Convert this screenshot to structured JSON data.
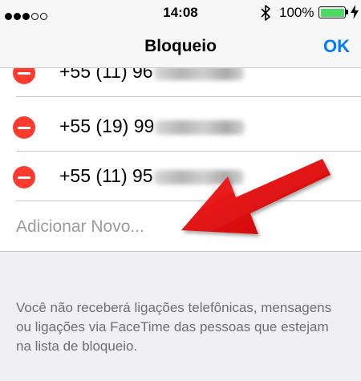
{
  "status_bar": {
    "time": "14:08",
    "battery_percent": "100%",
    "signal_bars_filled": 3,
    "signal_bars_total": 5,
    "battery_level": 1.0,
    "battery_color": "#4cd964"
  },
  "nav": {
    "title": "Bloqueio",
    "done_label": "OK",
    "accent_color": "#007aff"
  },
  "blocked_list": {
    "items": [
      {
        "number": "+55 (11) 96",
        "redacted": true
      },
      {
        "number": "+55 (19) 99",
        "redacted": true
      },
      {
        "number": "+55 (11) 95",
        "redacted": true
      }
    ],
    "add_new_label": "Adicionar Novo...",
    "delete_color": "#ff3b30"
  },
  "annotation": {
    "arrow_color": "#e8000b"
  },
  "footer": {
    "text": "Você não receberá ligações telefônicas, mensagens ou ligações via FaceTime das pessoas que estejam na lista de bloqueio."
  }
}
